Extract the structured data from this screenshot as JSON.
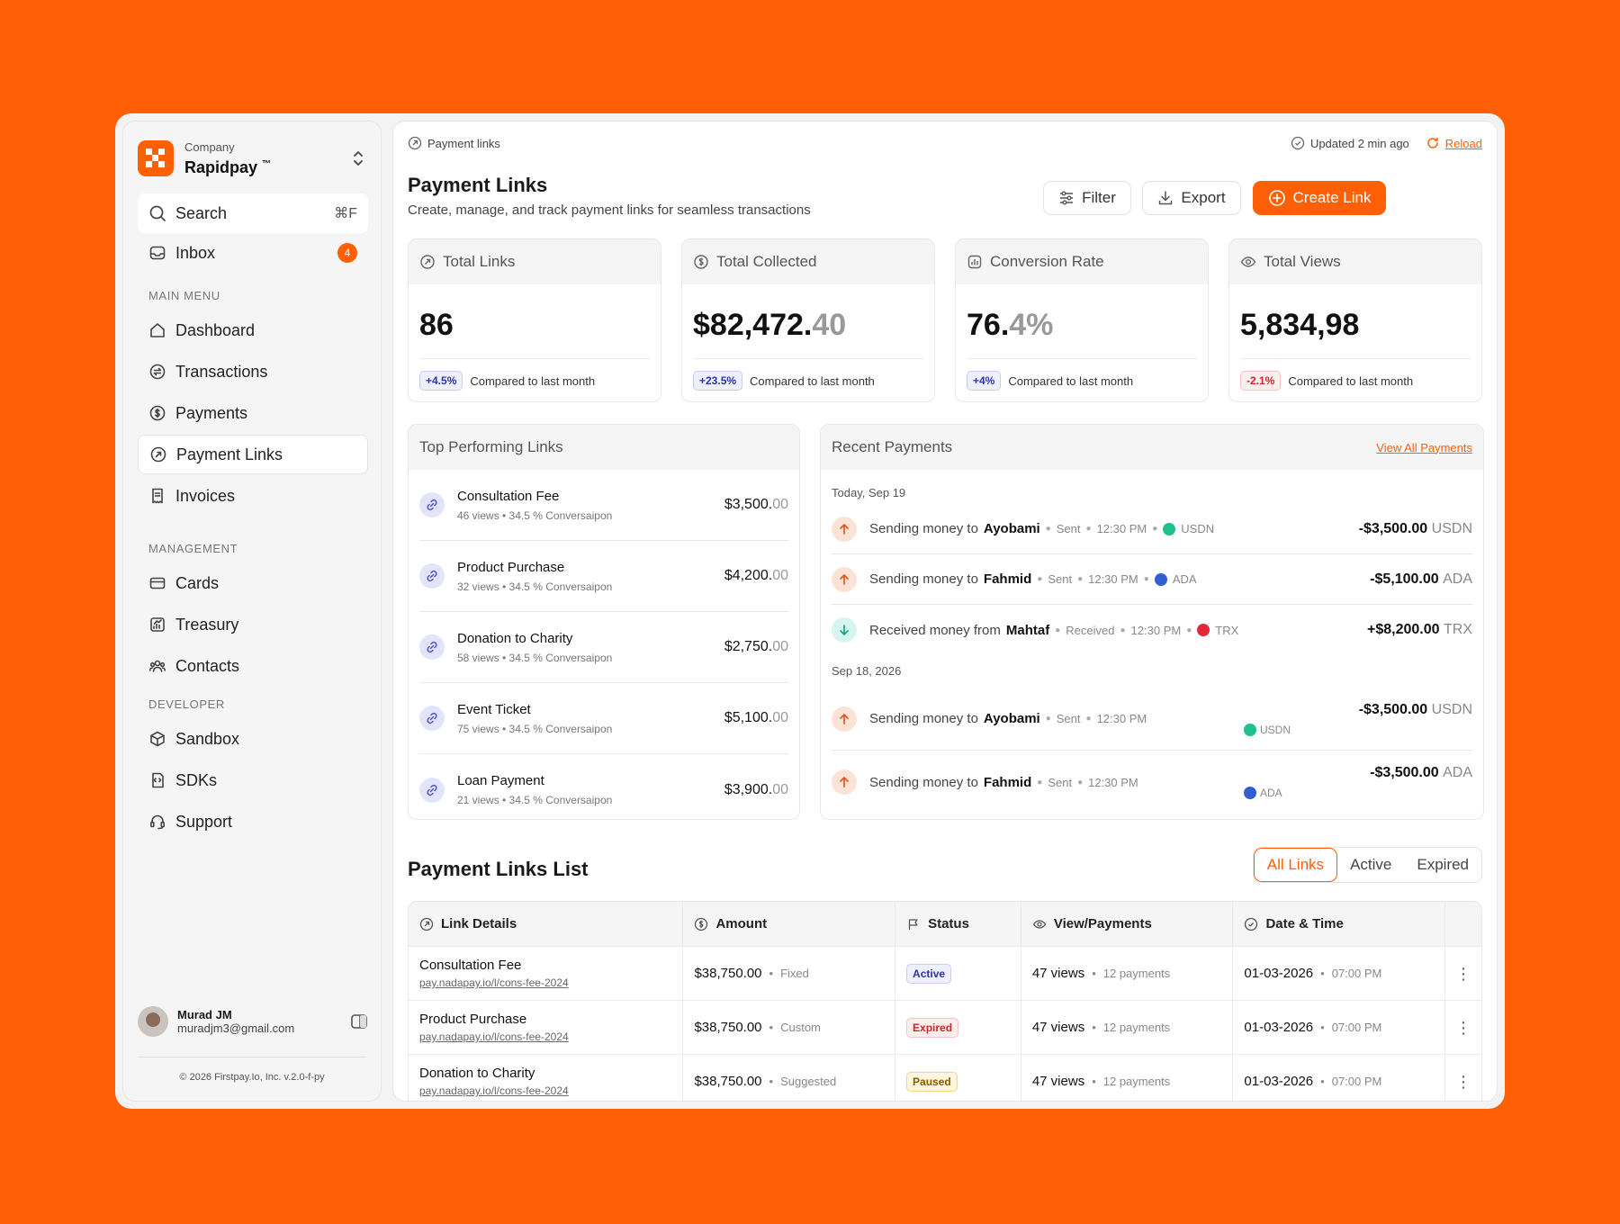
{
  "brand": {
    "sub": "Company",
    "name": "Rapidpay",
    "tm": "™",
    "accent": "#FF5F05"
  },
  "sidebar": {
    "search": {
      "label": "Search",
      "shortcut": "⌘F"
    },
    "inbox": {
      "label": "Inbox",
      "count": "4"
    },
    "main_menu_label": "MAIN MENU",
    "main_menu": [
      {
        "label": "Dashboard",
        "icon": "home-icon"
      },
      {
        "label": "Transactions",
        "icon": "transactions-icon"
      },
      {
        "label": "Payments",
        "icon": "dollar-circle-icon"
      },
      {
        "label": "Payment Links",
        "icon": "link-icon",
        "active": true
      },
      {
        "label": "Invoices",
        "icon": "invoice-icon"
      }
    ],
    "management_label": "MANAGEMENT",
    "management": [
      {
        "label": "Cards",
        "icon": "card-icon"
      },
      {
        "label": "Treasury",
        "icon": "treasury-icon"
      },
      {
        "label": "Contacts",
        "icon": "contacts-icon"
      }
    ],
    "developer_label": "DEVELOPER",
    "developer": [
      {
        "label": "Sandbox",
        "icon": "cube-icon"
      },
      {
        "label": "SDKs",
        "icon": "sdk-icon"
      },
      {
        "label": "Support",
        "icon": "headset-icon"
      }
    ],
    "user": {
      "name": "Murad JM",
      "email": "muradjm3@gmail.com"
    },
    "copyright": "© 2026 Firstpay.Io, Inc. v.2.0-f-py"
  },
  "header": {
    "breadcrumb": "Payment links",
    "updated": "Updated 2 min ago",
    "reload": "Reload",
    "title": "Payment Links",
    "subtitle": "Create, manage, and track payment links for seamless transactions",
    "filter": "Filter",
    "export": "Export",
    "create": "Create Link"
  },
  "stats": [
    {
      "label": "Total Links",
      "value_main": "86",
      "value_dim": "",
      "change": "+4.5%",
      "compare": "Compared to last month",
      "negative": false
    },
    {
      "label": "Total Collected",
      "value_main": "$82,472.",
      "value_dim": "40",
      "change": "+23.5%",
      "compare": "Compared to last month",
      "negative": false
    },
    {
      "label": "Conversion Rate",
      "value_main": "76.",
      "value_dim": "4%",
      "change": "+4%",
      "compare": "Compared to last month",
      "negative": false
    },
    {
      "label": "Total Views",
      "value_main": "5,834,98",
      "value_dim": "",
      "change": "-2.1%",
      "compare": "Compared to last month",
      "negative": true
    }
  ],
  "top_links": {
    "title": "Top Performing Links",
    "items": [
      {
        "name": "Consultation Fee",
        "meta": "46 views • 34.5 % Conversaipon",
        "amount": "$3,500.",
        "cents": "00"
      },
      {
        "name": "Product Purchase",
        "meta": "32 views • 34.5 % Conversaipon",
        "amount": "$4,200.",
        "cents": "00"
      },
      {
        "name": "Donation to Charity",
        "meta": "58 views • 34.5 % Conversaipon",
        "amount": "$2,750.",
        "cents": "00"
      },
      {
        "name": "Event Ticket",
        "meta": "75 views • 34.5 % Conversaipon",
        "amount": "$5,100.",
        "cents": "00"
      },
      {
        "name": "Loan Payment",
        "meta": "21 views • 34.5 % Conversaipon",
        "amount": "$3,900.",
        "cents": "00"
      }
    ]
  },
  "recent": {
    "title": "Recent Payments",
    "view_all": "View All Payments",
    "date1": "Today, Sep 19",
    "date2": "Sep 18, 2026",
    "items": [
      {
        "prefix": "Sending money to",
        "who": "Ayobami",
        "type": "Sent",
        "time": "12:30 PM",
        "coin": "USDN",
        "amount": "-$3,500.00",
        "cur": "USDN"
      },
      {
        "prefix": "Sending money to",
        "who": "Fahmid",
        "type": "Sent",
        "time": "12:30 PM",
        "coin": "ADA",
        "amount": "-$5,100.00",
        "cur": "ADA"
      },
      {
        "prefix": "Received money from",
        "who": "Mahtaf",
        "type": "Received",
        "time": "12:30 PM",
        "coin": "TRX",
        "amount": "+$8,200.00",
        "cur": "TRX"
      },
      {
        "prefix": "Sending money to",
        "who": "Ayobami",
        "type": "Sent",
        "time": "12:30 PM",
        "coin": "USDN",
        "amount": "-$3,500.00",
        "cur": "USDN"
      },
      {
        "prefix": "Sending money to",
        "who": "Fahmid",
        "type": "Sent",
        "time": "12:30 PM",
        "coin": "ADA",
        "amount": "-$3,500.00",
        "cur": "ADA"
      }
    ],
    "coin_colors": {
      "USDN": "#1fbf8f",
      "ADA": "#2f5fd0",
      "TRX": "#e5263a"
    }
  },
  "list": {
    "title": "Payment Links List",
    "tabs": [
      "All Links",
      "Active",
      "Expired"
    ],
    "columns": [
      "Link Details",
      "Amount",
      "Status",
      "View/Payments",
      "Date & Time"
    ],
    "rows": [
      {
        "name": "Consultation Fee",
        "url": "pay.nadapay.io/l/cons-fee-2024",
        "amount": "$38,750.00",
        "kind": "Fixed",
        "status": "Active",
        "views": "47 views",
        "payments": "12 payments",
        "date": "01-03-2026",
        "time": "07:00 PM"
      },
      {
        "name": "Product Purchase",
        "url": "pay.nadapay.io/l/cons-fee-2024",
        "amount": "$38,750.00",
        "kind": "Custom",
        "status": "Expired",
        "views": "47 views",
        "payments": "12 payments",
        "date": "01-03-2026",
        "time": "07:00 PM"
      },
      {
        "name": "Donation to Charity",
        "url": "pay.nadapay.io/l/cons-fee-2024",
        "amount": "$38,750.00",
        "kind": "Suggested",
        "status": "Paused",
        "views": "47 views",
        "payments": "12 payments",
        "date": "01-03-2026",
        "time": "07:00 PM"
      }
    ]
  }
}
